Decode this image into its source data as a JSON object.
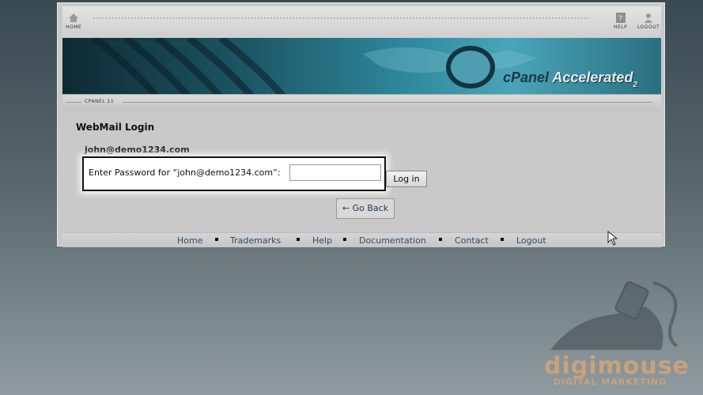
{
  "toolbar": {
    "home_label": "HOME",
    "help_label": "HELP",
    "logout_label": "LOGOUT"
  },
  "banner": {
    "brand_c": "cPanel",
    "brand_text": "Accelerated",
    "brand_sup": "2"
  },
  "nav": {
    "label": "CPANEL 11"
  },
  "login": {
    "title": "WebMail Login",
    "email": "john@demo1234.com",
    "password_label": "Enter Password for “john@demo1234.com”:",
    "password_value": "",
    "login_button": "Log in",
    "go_back": "← Go Back"
  },
  "footer": {
    "links": [
      "Home",
      "Trademarks",
      "Help",
      "Documentation",
      "Contact",
      "Logout"
    ]
  },
  "watermark": {
    "name": "digimouse",
    "sub": "DIGITAL MARKETING"
  }
}
